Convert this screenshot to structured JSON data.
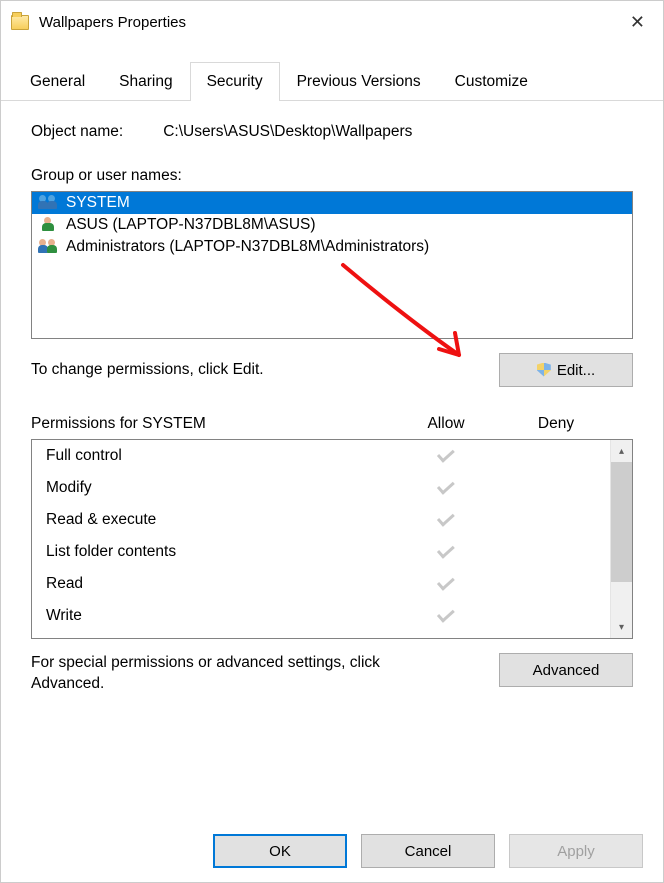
{
  "window": {
    "title": "Wallpapers Properties"
  },
  "tabs": {
    "general": "General",
    "sharing": "Sharing",
    "security": "Security",
    "previous": "Previous Versions",
    "customize": "Customize"
  },
  "object": {
    "label": "Object name:",
    "path": "C:\\Users\\ASUS\\Desktop\\Wallpapers"
  },
  "groups": {
    "label": "Group or user names:",
    "items": [
      {
        "name": "SYSTEM",
        "icon": "multi",
        "selected": true
      },
      {
        "name": "ASUS (LAPTOP-N37DBL8M\\ASUS)",
        "icon": "single",
        "selected": false
      },
      {
        "name": "Administrators (LAPTOP-N37DBL8M\\Administrators)",
        "icon": "admin",
        "selected": false
      }
    ]
  },
  "edit": {
    "hint": "To change permissions, click Edit.",
    "button": "Edit..."
  },
  "perms": {
    "header_for": "Permissions for SYSTEM",
    "col_allow": "Allow",
    "col_deny": "Deny",
    "rows": [
      {
        "name": "Full control",
        "allow": true,
        "deny": false
      },
      {
        "name": "Modify",
        "allow": true,
        "deny": false
      },
      {
        "name": "Read & execute",
        "allow": true,
        "deny": false
      },
      {
        "name": "List folder contents",
        "allow": true,
        "deny": false
      },
      {
        "name": "Read",
        "allow": true,
        "deny": false
      },
      {
        "name": "Write",
        "allow": true,
        "deny": false
      }
    ]
  },
  "advanced": {
    "hint": "For special permissions or advanced settings, click Advanced.",
    "button": "Advanced"
  },
  "buttons": {
    "ok": "OK",
    "cancel": "Cancel",
    "apply": "Apply"
  }
}
